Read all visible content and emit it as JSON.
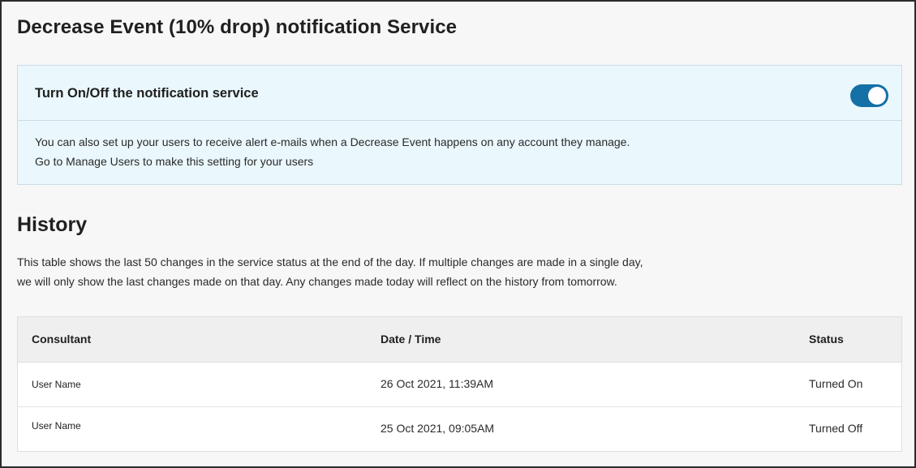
{
  "page": {
    "title": "Decrease Event (10% drop) notification Service"
  },
  "notification": {
    "toggle_label": "Turn On/Off the notification service",
    "toggle_on": true,
    "toggle_color": "#1470a6",
    "description_line1": "You can also set up your users to receive alert e-mails when a Decrease Event happens on any account they manage.",
    "description_line2": "Go to Manage Users to make this setting for your users"
  },
  "history": {
    "title": "History",
    "description_line1": "This table shows the last 50 changes in the service status at the end of the day. If multiple changes are made in a single day,",
    "description_line2": "we will only show the last changes made on that day. Any changes made today will reflect on the history from tomorrow.",
    "table": {
      "headers": {
        "consultant": "Consultant",
        "date_time": "Date / Time",
        "status": "Status"
      },
      "rows": [
        {
          "consultant": "User Name",
          "date_time": "26 Oct 2021, 11:39AM",
          "status": "Turned On"
        },
        {
          "consultant": "User Name",
          "date_time": "25 Oct 2021, 09:05AM",
          "status": "Turned Off"
        }
      ]
    }
  }
}
